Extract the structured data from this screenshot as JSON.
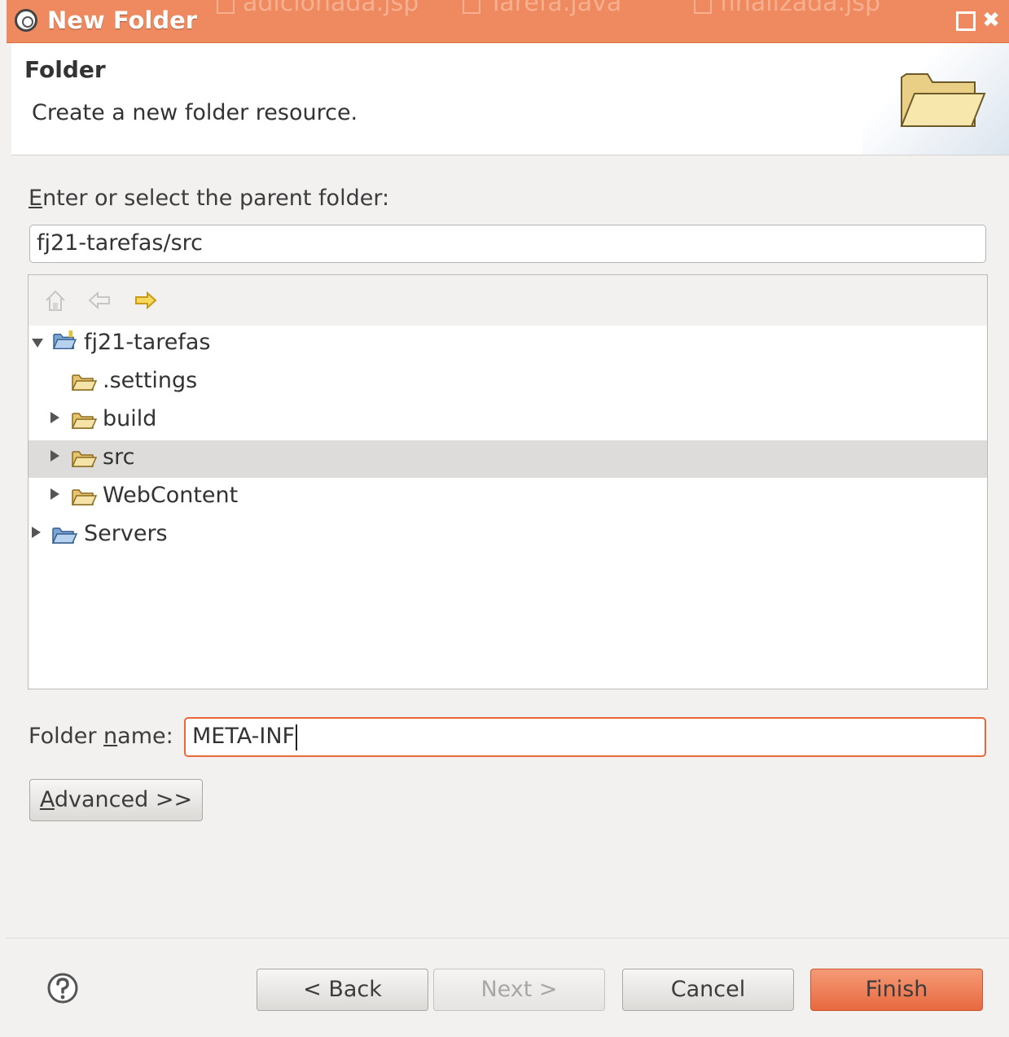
{
  "window": {
    "title": "New Folder",
    "background_tabs": [
      "adicionada.jsp",
      "Tarefa.java",
      "finalizada.jsp"
    ]
  },
  "banner": {
    "title": "Folder",
    "description": "Create a new folder resource."
  },
  "parent": {
    "label_first": "E",
    "label_rest": "nter or select the parent folder:",
    "value": "fj21-tarefas/src"
  },
  "tree": {
    "items": [
      {
        "label": "fj21-tarefas",
        "expanded": true
      },
      {
        "label": ".settings"
      },
      {
        "label": "build"
      },
      {
        "label": "src",
        "selected": true
      },
      {
        "label": "WebContent"
      },
      {
        "label": "Servers"
      }
    ]
  },
  "folder_name": {
    "label_pre": "Folder ",
    "label_u": "n",
    "label_post": "ame:",
    "value": "META-INF"
  },
  "advanced": {
    "label_u": "A",
    "label_rest": "dvanced >>"
  },
  "buttons": {
    "back": "< Back",
    "next": "Next >",
    "cancel": "Cancel",
    "finish": "Finish"
  },
  "colors": {
    "titlebar": "#ef8a60",
    "accent": "#e8683c"
  },
  "icons": [
    "eclipse-icon",
    "folder-large-icon",
    "home-icon",
    "back-arrow-icon",
    "forward-arrow-icon",
    "project-folder-icon",
    "folder-icon",
    "help-icon"
  ]
}
